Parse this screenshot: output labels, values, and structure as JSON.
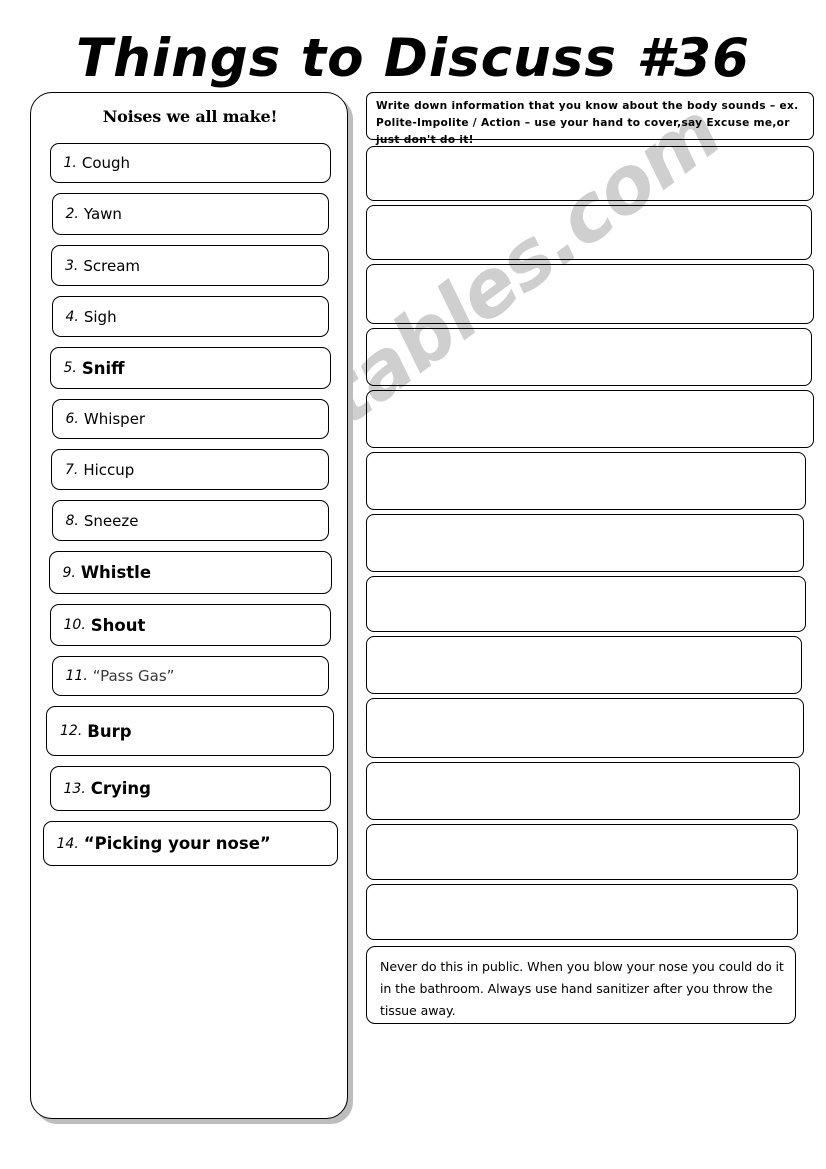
{
  "title": "Things to Discuss #36",
  "left_panel": {
    "header": "Noises we all make!",
    "items": [
      {
        "num": "1.",
        "text": "Cough",
        "style": "regular"
      },
      {
        "num": "2.",
        "text": "Yawn",
        "style": "regular"
      },
      {
        "num": "3.",
        "text": "Scream",
        "style": "regular"
      },
      {
        "num": "4.",
        "text": "Sigh",
        "style": "regular"
      },
      {
        "num": "5.",
        "text": "Sniff",
        "style": "bold"
      },
      {
        "num": "6.",
        "text": "Whisper",
        "style": "regular"
      },
      {
        "num": "7.",
        "text": "Hiccup",
        "style": "regular"
      },
      {
        "num": "8.",
        "text": "Sneeze",
        "style": "regular"
      },
      {
        "num": "9.",
        "text": "Whistle",
        "style": "bold"
      },
      {
        "num": "10.",
        "text": "Shout",
        "style": "bold"
      },
      {
        "num": "11.",
        "text": "“Pass Gas”",
        "style": "light"
      },
      {
        "num": "12.",
        "text": "Burp",
        "style": "bold"
      },
      {
        "num": "13.",
        "text": "Crying",
        "style": "bold"
      },
      {
        "num": "14.",
        "text": "“Picking your nose”",
        "style": "bold"
      }
    ]
  },
  "right_column": {
    "instruction": "Write down information that you know about the body sounds – ex. Polite-Impolite / Action – use your hand to cover,say Excuse me,or just don't do it!",
    "answer_box_count": 13,
    "note": "Never do this in public.  When you blow your nose you could do it in the bathroom.   Always use hand sanitizer after you throw the tissue away."
  },
  "watermark": {
    "text": "ESLprintables.com",
    "color": "#cfcfcf"
  },
  "colors": {
    "ink": "#000000",
    "paper": "#ffffff",
    "shadow": "#bdbdbd"
  }
}
